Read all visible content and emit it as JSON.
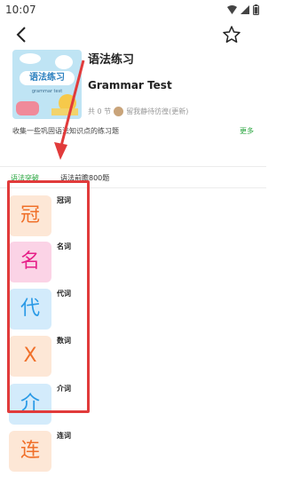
{
  "status_bar": {
    "time": "10:07",
    "icons": [
      "wifi-icon",
      "signal-icon",
      "battery-icon"
    ]
  },
  "header": {
    "back_icon": "back-arrow-icon",
    "star_icon": "star-outline-icon"
  },
  "book": {
    "cover_title": "语法练习",
    "cover_subtitle": "grammar test",
    "title": "语法练习",
    "subtitle": "Grammar Test",
    "count_text": "共 0 节",
    "author": "留我静待彷徨(更新)",
    "description": "收集一些巩固语法知识点的练习题",
    "more_label": "更多"
  },
  "tabs": [
    {
      "label": "语法突破",
      "active": true
    },
    {
      "label": "语法前瞻800题",
      "active": false
    }
  ],
  "items": [
    {
      "char": "冠",
      "label": "冠词",
      "tile_bg": "#fde7d6",
      "char_color": "#f0702a"
    },
    {
      "char": "名",
      "label": "名词",
      "tile_bg": "#fbd3e6",
      "char_color": "#e61f88"
    },
    {
      "char": "代",
      "label": "代词",
      "tile_bg": "#d3ebfb",
      "char_color": "#2a9ae6"
    },
    {
      "char": "X",
      "label": "数词",
      "tile_bg": "#fde7d6",
      "char_color": "#f0702a"
    },
    {
      "char": "介",
      "label": "介词",
      "tile_bg": "#d3ebfb",
      "char_color": "#2a9ae6"
    },
    {
      "char": "连",
      "label": "连词",
      "tile_bg": "#fde7d6",
      "char_color": "#f0702a"
    }
  ],
  "colors": {
    "accent_green": "#2aa53f",
    "annotation_red": "#e13b3b"
  }
}
